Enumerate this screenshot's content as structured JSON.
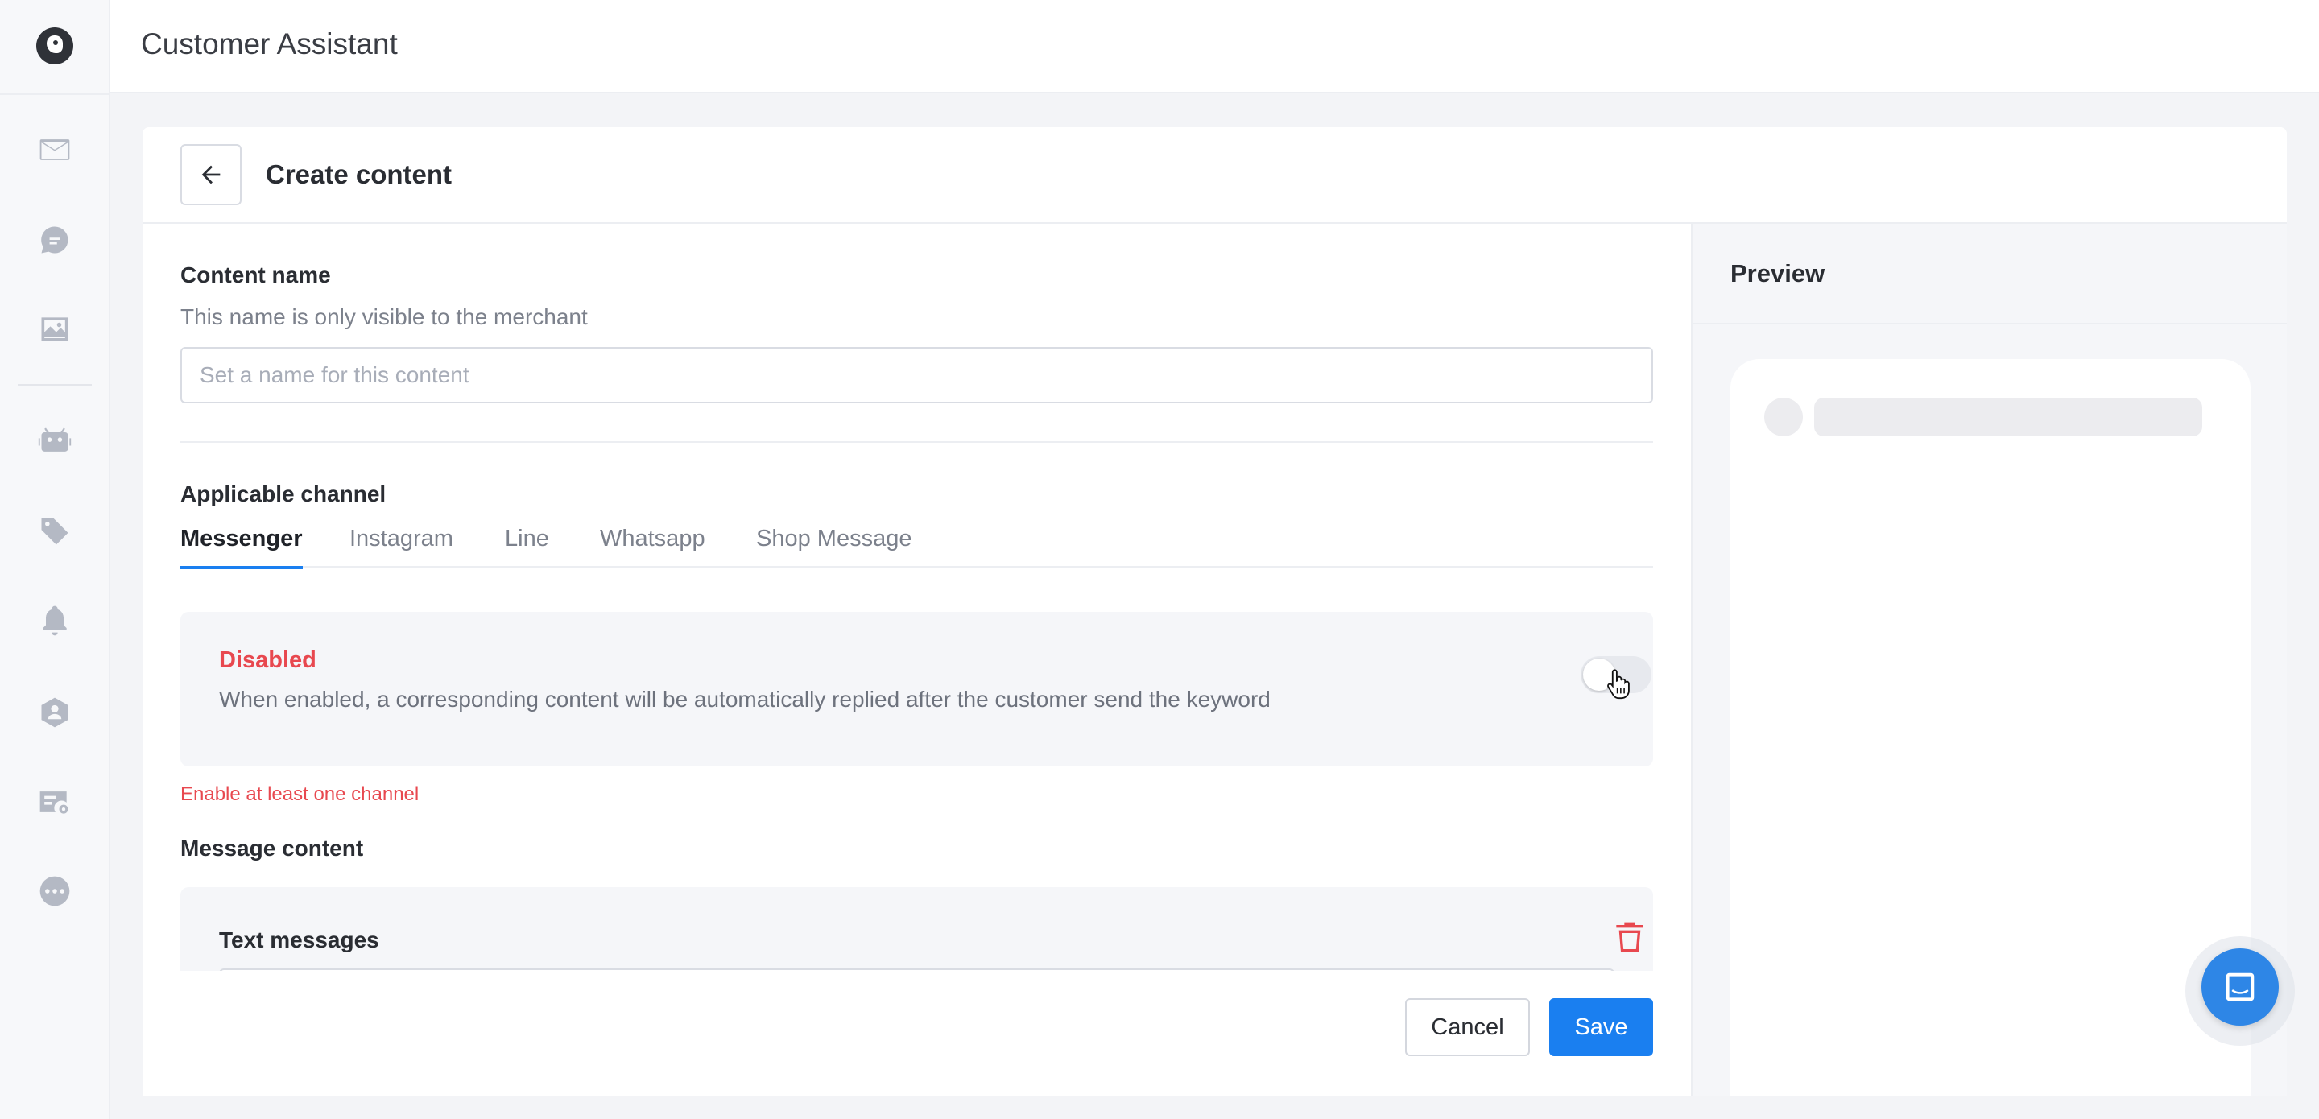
{
  "app": {
    "title": "Customer Assistant"
  },
  "sidebar": {
    "items": [
      {
        "icon": "inbox-icon"
      },
      {
        "icon": "chat-bubble-icon"
      },
      {
        "icon": "image-icon"
      },
      {
        "icon": "robot-icon"
      },
      {
        "icon": "tags-icon"
      },
      {
        "icon": "bell-icon"
      },
      {
        "icon": "contact-shield-icon"
      },
      {
        "icon": "card-settings-icon"
      },
      {
        "icon": "more-icon"
      }
    ]
  },
  "header": {
    "title": "Create content"
  },
  "form": {
    "content_name_label": "Content name",
    "content_name_hint": "This name is only visible to the merchant",
    "content_name_placeholder": "Set a name for this content",
    "content_name_value": "",
    "channel_label": "Applicable channel",
    "tabs": [
      {
        "label": "Messenger",
        "active": true
      },
      {
        "label": "Instagram",
        "active": false
      },
      {
        "label": "Line",
        "active": false
      },
      {
        "label": "Whatsapp",
        "active": false
      },
      {
        "label": "Shop Message",
        "active": false
      }
    ],
    "channel_status": "Disabled",
    "channel_description": "When enabled, a corresponding content will be automatically replied after the customer send the keyword",
    "channel_enabled": false,
    "channel_error": "Enable at least one channel",
    "message_content_label": "Message content",
    "text_messages_label": "Text messages"
  },
  "footer": {
    "cancel_label": "Cancel",
    "save_label": "Save"
  },
  "preview": {
    "title": "Preview"
  },
  "colors": {
    "accent": "#1a7ff0",
    "error": "#e8484f",
    "fab": "#2e86e6"
  }
}
